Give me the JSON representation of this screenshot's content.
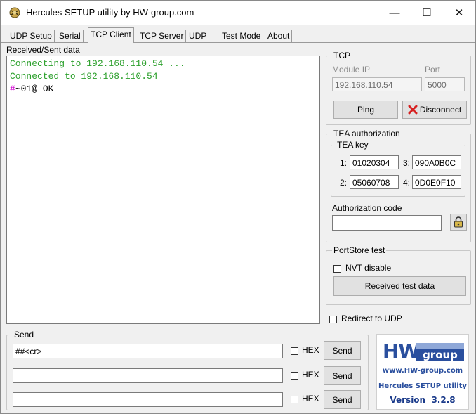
{
  "window": {
    "title": "Hercules SETUP utility by HW-group.com",
    "minimize": "—",
    "maximize": "☐",
    "close": "✕"
  },
  "tabs": [
    "UDP Setup",
    "Serial",
    "TCP Client",
    "TCP Server",
    "UDP",
    "Test Mode",
    "About"
  ],
  "active_tab": "TCP Client",
  "received": {
    "label": "Received/Sent data",
    "lines": [
      {
        "text": "Connecting to 192.168.110.54 ...",
        "color": "#2ca02c"
      },
      {
        "text": "Connected to 192.168.110.54",
        "color": "#2ca02c"
      },
      {
        "prefix": "#",
        "prefix_color": "#d000d0",
        "text": "~01@ OK",
        "color": "#000000"
      }
    ]
  },
  "tcp": {
    "group_label": "TCP",
    "module_ip_label": "Module IP",
    "module_ip": "192.168.110.54",
    "port_label": "Port",
    "port": "5000",
    "ping": "Ping",
    "disconnect": "Disconnect"
  },
  "tea": {
    "group_label": "TEA authorization",
    "key_label": "TEA key",
    "k1_label": "1:",
    "k1": "01020304",
    "k2_label": "2:",
    "k2": "05060708",
    "k3_label": "3:",
    "k3": "090A0B0C",
    "k4_label": "4:",
    "k4": "0D0E0F10",
    "auth_code_label": "Authorization code",
    "auth_code": ""
  },
  "portstore": {
    "group_label": "PortStore test",
    "nvt_disable": "NVT disable",
    "received_test_data": "Received test data"
  },
  "redirect_udp": "Redirect to UDP",
  "send": {
    "group_label": "Send",
    "rows": [
      {
        "value": "##<cr>",
        "hex": "HEX",
        "button": "Send"
      },
      {
        "value": "",
        "hex": "HEX",
        "button": "Send"
      },
      {
        "value": "",
        "hex": "HEX",
        "button": "Send"
      }
    ]
  },
  "logo": {
    "brand_hw": "HW",
    "brand_group": "group",
    "url": "www.HW-group.com",
    "product": "Hercules SETUP utility",
    "version": "Version  3.2.8",
    "colors": {
      "blue": "#2a4f9e",
      "grey": "#8fa8d8"
    }
  }
}
